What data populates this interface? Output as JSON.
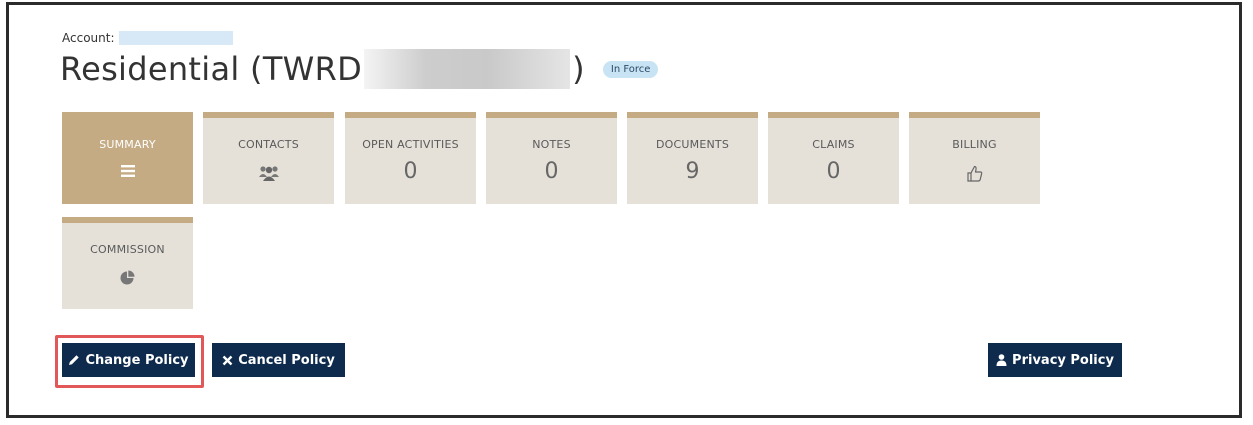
{
  "account": {
    "label": "Account:"
  },
  "policy": {
    "title_prefix": "Residential (TWRD",
    "title_suffix": ")",
    "status": "In Force"
  },
  "tiles": [
    {
      "label": "SUMMARY",
      "icon": "menu-icon"
    },
    {
      "label": "CONTACTS",
      "icon": "users-icon"
    },
    {
      "label": "OPEN ACTIVITIES",
      "value": "0"
    },
    {
      "label": "NOTES",
      "value": "0"
    },
    {
      "label": "DOCUMENTS",
      "value": "9"
    },
    {
      "label": "CLAIMS",
      "value": "0"
    },
    {
      "label": "BILLING",
      "icon": "thumbs-up-icon"
    },
    {
      "label": "COMMISSION",
      "icon": "pie-chart-icon"
    }
  ],
  "actions": {
    "change_policy": "Change Policy",
    "cancel_policy": "Cancel Policy",
    "privacy_policy": "Privacy Policy"
  },
  "colors": {
    "tile_active": "#c4ab84",
    "tile_bg": "#e5e1d9",
    "button_bg": "#0e2a4c",
    "highlight": "#e25757",
    "badge_bg": "#c8e3f3"
  }
}
